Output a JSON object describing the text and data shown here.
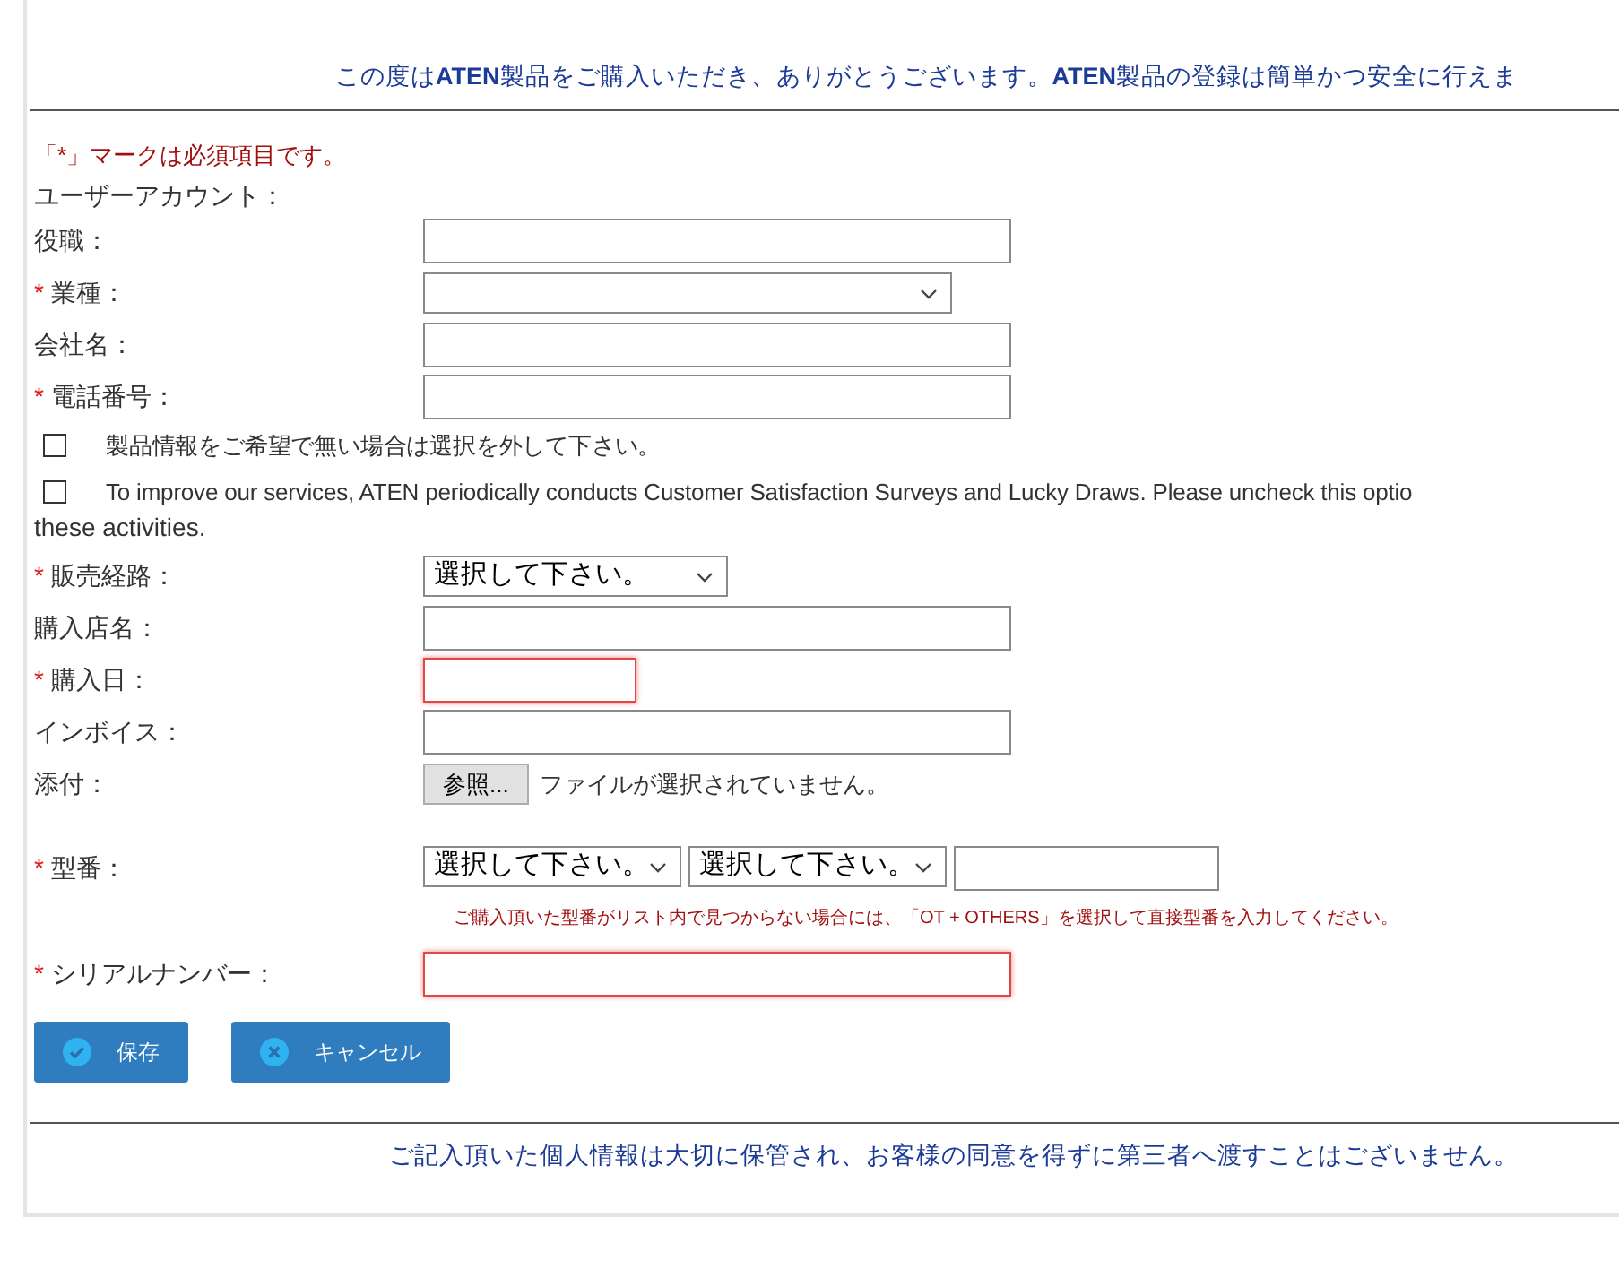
{
  "header": {
    "text": "この度は**ATEN**製品をご購入いただき、ありがとうございます。**ATEN**製品の登録は簡単かつ安全に行えま"
  },
  "required_note": "「*」マークは必須項目です。",
  "required_mark": "*",
  "account_label": "ユーザーアカウント：",
  "rows": [
    {
      "kind": "input",
      "label": "役職：",
      "required": false,
      "invalid": false
    },
    {
      "kind": "select",
      "label": "業種：",
      "required": true,
      "value": ""
    },
    {
      "kind": "input",
      "label": "会社名：",
      "required": false,
      "invalid": false
    },
    {
      "kind": "input",
      "label": "電話番号：",
      "required": true,
      "invalid": false
    },
    {
      "kind": "checkbox",
      "label": "製品情報をご希望で無い場合は選択を外して下さい。",
      "checked": false
    },
    {
      "kind": "checkbox",
      "label": "To improve our services, ATEN periodically conducts Customer Satisfaction Surveys and Lucky Draws. Please uncheck this optio",
      "continuation": "these activities.",
      "checked": false
    },
    {
      "kind": "select",
      "label": "販売経路：",
      "required": true,
      "value": "選択して下さい。"
    },
    {
      "kind": "input",
      "label": "購入店名：",
      "required": false,
      "invalid": false
    },
    {
      "kind": "date",
      "label": "購入日：",
      "required": true,
      "invalid": true
    },
    {
      "kind": "input",
      "label": "インボイス：",
      "required": false,
      "invalid": false
    },
    {
      "kind": "file",
      "label": "添付：",
      "required": false,
      "button": "参照...",
      "status": "ファイルが選択されていません。"
    },
    {
      "kind": "model",
      "label": "型番：",
      "required": true,
      "selects": [
        "選択して下さい。",
        "選択して下さい。"
      ],
      "hint": "ご購入頂いた型番がリスト内で見つからない場合には、「OT + OTHERS」を選択して直接型番を入力してください。"
    },
    {
      "kind": "input",
      "label": "シリアルナンバー：",
      "required": true,
      "invalid": true
    }
  ],
  "buttons": [
    {
      "kind": "save",
      "label": "保存"
    },
    {
      "kind": "cancel",
      "label": "キャンセル"
    }
  ],
  "footer": "ご記入頂いた個人情報は大切に保管され、お客様の同意を得ずに第三者へ渡すことはございません。"
}
